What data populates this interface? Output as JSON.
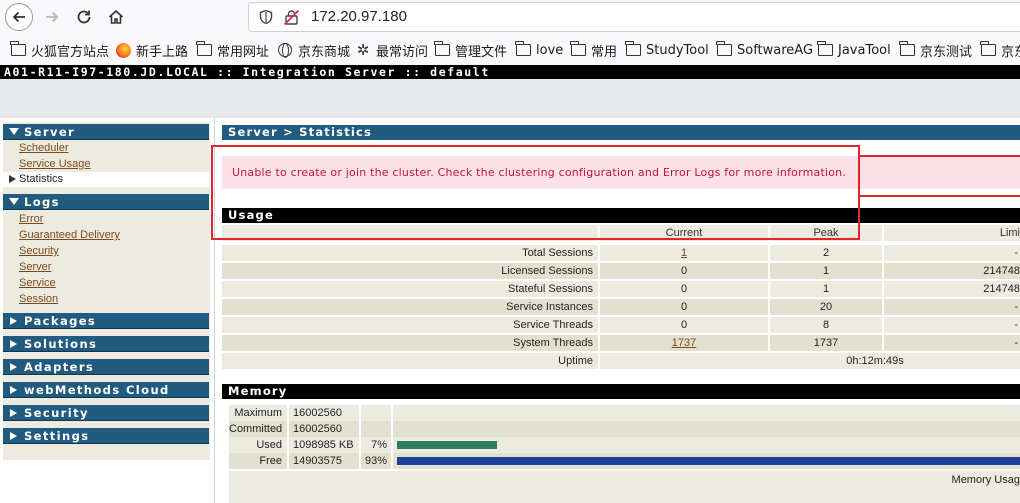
{
  "browser": {
    "url": "172.20.97.180",
    "bookmarks": [
      "火狐官方站点",
      "新手上路",
      "常用网址",
      "京东商城",
      "最常访问",
      "管理文件",
      "love",
      "常用",
      "StudyTool",
      "SoftwareAG",
      "JavaTool",
      "京东测试",
      "京东"
    ]
  },
  "app": {
    "title": "A01-R11-I97-180.JD.LOCAL :: Integration Server :: default"
  },
  "sidebar": {
    "server": {
      "label": "Server",
      "items": [
        "Scheduler",
        "Service Usage"
      ],
      "active": "Statistics"
    },
    "logs": {
      "label": "Logs",
      "items": [
        "Error",
        "Guaranteed Delivery",
        "Security",
        "Server",
        "Service",
        "Session"
      ]
    },
    "collapsed": [
      "Packages",
      "Solutions",
      "Adapters",
      "webMethods Cloud",
      "Security",
      "Settings"
    ]
  },
  "main": {
    "breadcrumb": "Server > Statistics",
    "error_message": "Unable to create or join the cluster. Check the clustering configuration and Error Logs for more information.",
    "usage": {
      "title": "Usage",
      "columns": [
        "Current",
        "Peak",
        "Limi"
      ],
      "rows": [
        {
          "label": "Total Sessions",
          "current": "1",
          "peak": "2",
          "limit": "-"
        },
        {
          "label": "Licensed Sessions",
          "current": "0",
          "peak": "1",
          "limit": "214748"
        },
        {
          "label": "Stateful Sessions",
          "current": "0",
          "peak": "1",
          "limit": "214748"
        },
        {
          "label": "Service Instances",
          "current": "0",
          "peak": "20",
          "limit": "-"
        },
        {
          "label": "Service Threads",
          "current": "0",
          "peak": "8",
          "limit": "-"
        },
        {
          "label": "System Threads",
          "current": "1737",
          "peak": "1737",
          "limit": "-"
        }
      ],
      "uptime_label": "Uptime",
      "uptime_value": "0h:12m:49s"
    },
    "memory": {
      "title": "Memory",
      "rows": [
        {
          "label": "Maximum",
          "value": "16002560 KB",
          "pct": ""
        },
        {
          "label": "Committed",
          "value": "16002560 KB",
          "pct": ""
        },
        {
          "label": "Used",
          "value": "1098985 KB",
          "pct": "7%",
          "fraction": 0.07
        },
        {
          "label": "Free",
          "value": "14903575 KB",
          "pct": "93%",
          "fraction": 0.93
        }
      ],
      "footer": "Memory Usag"
    },
    "colors": {
      "used_bar": "#2e7d5b",
      "free_bar": "#1f3f99",
      "header": "#225b80"
    }
  }
}
